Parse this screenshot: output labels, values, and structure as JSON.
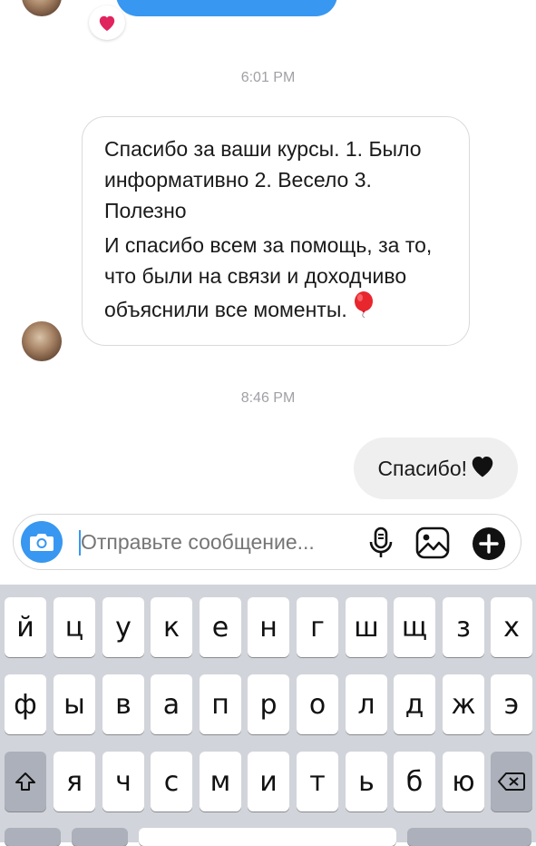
{
  "thread": {
    "top_reaction": "♥",
    "timestamp_1": "6:01 PM",
    "incoming_message": {
      "para1": "Спасибо за ваши курсы. 1. Было информативно 2. Весело 3. Полезно",
      "para2": "И спасибо всем за помощь, за то, что были на связи и доходчиво объяснили все моменты.",
      "emoji": "balloon"
    },
    "timestamp_2": "8:46 PM",
    "outgoing_message": {
      "text": "Спасибо!",
      "emoji": "black-heart"
    }
  },
  "composer": {
    "placeholder": "Отправьте сообщение...",
    "icons": [
      "camera-icon",
      "microphone-icon",
      "gallery-icon",
      "plus-icon"
    ]
  },
  "keyboard": {
    "row1": [
      "й",
      "ц",
      "у",
      "к",
      "е",
      "н",
      "г",
      "ш",
      "щ",
      "з",
      "х"
    ],
    "row2": [
      "ф",
      "ы",
      "в",
      "а",
      "п",
      "р",
      "о",
      "л",
      "д",
      "ж",
      "э"
    ],
    "row3": [
      "я",
      "ч",
      "с",
      "м",
      "и",
      "т",
      "ь",
      "б",
      "ю"
    ],
    "shift_icon": "shift-icon",
    "backspace_icon": "backspace-icon"
  },
  "colors": {
    "accent": "#3897f0",
    "outgoing_bubble": "#efefef",
    "keyboard_bg": "#d1d4da",
    "timestamp": "#a0a0a6"
  }
}
